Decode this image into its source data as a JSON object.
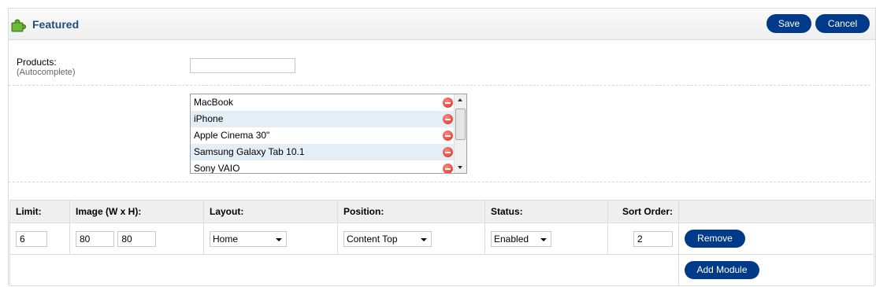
{
  "header": {
    "title": "Featured",
    "icon": "puzzle-icon",
    "save_label": "Save",
    "cancel_label": "Cancel"
  },
  "form": {
    "products_label": "Products:",
    "products_sublabel": "(Autocomplete)",
    "products_input_value": ""
  },
  "products": [
    {
      "name": "MacBook"
    },
    {
      "name": "iPhone"
    },
    {
      "name": "Apple Cinema 30\""
    },
    {
      "name": "Samsung Galaxy Tab 10.1"
    },
    {
      "name": "Sony VAIO"
    }
  ],
  "modules": {
    "headers": {
      "limit": "Limit:",
      "image": "Image (W x H):",
      "layout": "Layout:",
      "position": "Position:",
      "status": "Status:",
      "sort_order": "Sort Order:"
    },
    "row": {
      "limit": "6",
      "image_w": "80",
      "image_h": "80",
      "layout": "Home",
      "position": "Content Top",
      "status": "Enabled",
      "sort_order": "2",
      "remove_label": "Remove"
    },
    "add_module_label": "Add Module"
  },
  "colors": {
    "button": "#003a88",
    "title": "#1f4f7b",
    "accent_green": "#5aa02c"
  }
}
